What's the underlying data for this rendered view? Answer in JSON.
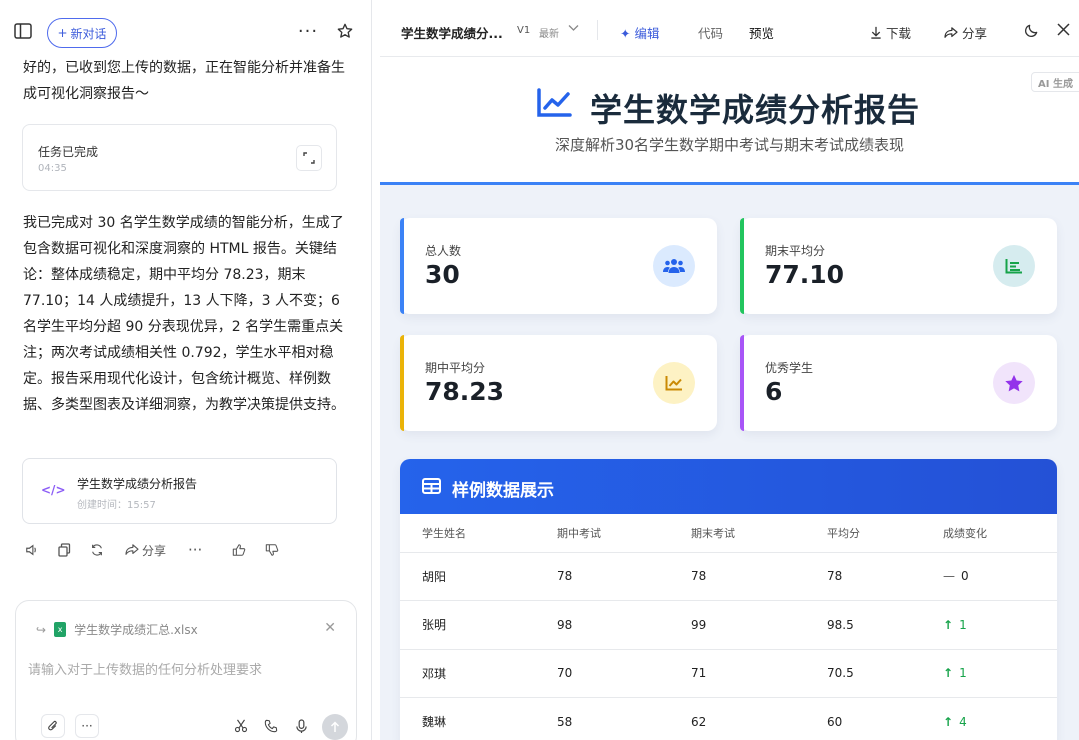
{
  "chat": {
    "new_chat_label": "新对话",
    "message1": "好的，已收到您上传的数据，正在智能分析并准备生成可视化洞察报告～",
    "task": {
      "title": "任务已完成",
      "time": "04:35"
    },
    "message2": "我已完成对 30 名学生数学成绩的智能分析，生成了包含数据可视化和深度洞察的 HTML 报告。关键结论：整体成绩稳定，期中平均分 78.23，期末 77.10；14 人成绩提升，13 人下降，3 人不变；6 名学生平均分超 90 分表现优异，2 名学生需重点关注；两次考试成绩相关性 0.792，学生水平相对稳定。报告采用现代化设计，包含统计概览、样例数据、多类型图表及详细洞察，为教学决策提供支持。",
    "report": {
      "title": "学生数学成绩分析报告",
      "time": "创建时间：15:57"
    },
    "share_label": "分享",
    "input": {
      "attachment": "学生数学成绩汇总.xlsx",
      "placeholder": "请输入对于上传数据的任何分析处理要求"
    }
  },
  "preview": {
    "file_title": "学生数学成绩分...",
    "version": "V1",
    "version_tag": "最新",
    "tabs": {
      "edit": "编辑",
      "code": "代码",
      "preview": "预览"
    },
    "actions": {
      "download": "下载",
      "share": "分享"
    },
    "ai_badge": "AI 生成",
    "report": {
      "title": "学生数学成绩分析报告",
      "subtitle": "深度解析30名学生数学期中考试与期末考试成绩表现",
      "stats": [
        {
          "label": "总人数",
          "value": "30",
          "color": "#3b82f6"
        },
        {
          "label": "期末平均分",
          "value": "77.10",
          "color": "#22c55e"
        },
        {
          "label": "期中平均分",
          "value": "78.23",
          "color": "#eab308"
        },
        {
          "label": "优秀学生",
          "value": "6",
          "color": "#a855f7"
        }
      ],
      "sample_title": "样例数据展示",
      "columns": [
        "学生姓名",
        "期中考试",
        "期末考试",
        "平均分",
        "成绩变化"
      ],
      "rows": [
        {
          "name": "胡阳",
          "mid": "78",
          "final": "78",
          "avg": "78",
          "change_symbol": "—",
          "change": "0",
          "trend": "flat"
        },
        {
          "name": "张明",
          "mid": "98",
          "final": "99",
          "avg": "98.5",
          "change_symbol": "↑",
          "change": "1",
          "trend": "up"
        },
        {
          "name": "邓琪",
          "mid": "70",
          "final": "71",
          "avg": "70.5",
          "change_symbol": "↑",
          "change": "1",
          "trend": "up"
        },
        {
          "name": "魏琳",
          "mid": "58",
          "final": "62",
          "avg": "60",
          "change_symbol": "↑",
          "change": "4",
          "trend": "up"
        }
      ]
    }
  }
}
